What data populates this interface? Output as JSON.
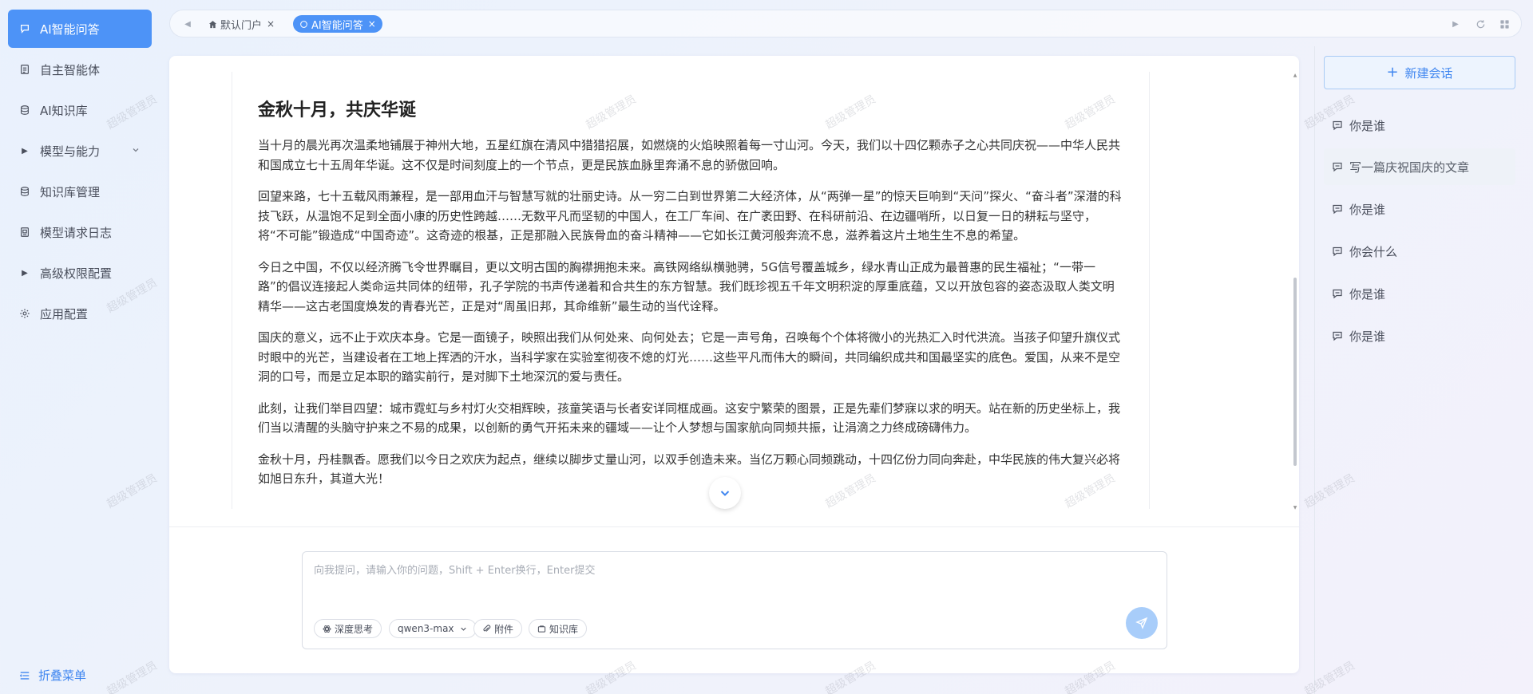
{
  "sidebar": {
    "items": [
      {
        "label": "AI智能问答",
        "icon": "chat-icon",
        "active": true
      },
      {
        "label": "自主智能体",
        "icon": "document-icon"
      },
      {
        "label": "AI知识库",
        "icon": "database-icon"
      },
      {
        "label": "模型与能力",
        "icon": "caret-right-icon",
        "expandable": true
      },
      {
        "label": "知识库管理",
        "icon": "database-icon"
      },
      {
        "label": "模型请求日志",
        "icon": "log-icon"
      },
      {
        "label": "高级权限配置",
        "icon": "caret-right-icon"
      },
      {
        "label": "应用配置",
        "icon": "gear-icon"
      }
    ],
    "collapse_label": "折叠菜单"
  },
  "tabs": [
    {
      "label": "默认门户",
      "icon": "home-icon",
      "active": false
    },
    {
      "label": "AI智能问答",
      "icon": "chat-icon",
      "active": true
    }
  ],
  "article": {
    "title": "金秋十月，共庆华诞",
    "paragraphs": [
      "当十月的晨光再次温柔地铺展于神州大地，五星红旗在清风中猎猎招展，如燃烧的火焰映照着每一寸山河。今天，我们以十四亿颗赤子之心共同庆祝——中华人民共和国成立七十五周年华诞。这不仅是时间刻度上的一个节点，更是民族血脉里奔涌不息的骄傲回响。",
      "回望来路，七十五载风雨兼程，是一部用血汗与智慧写就的壮丽史诗。从一穷二白到世界第二大经济体，从“两弹一星”的惊天巨响到“天问”探火、“奋斗者”深潜的科技飞跃，从温饱不足到全面小康的历史性跨越……无数平凡而坚韧的中国人，在工厂车间、在广袤田野、在科研前沿、在边疆哨所，以日复一日的耕耘与坚守，将“不可能”锻造成“中国奇迹”。这奇迹的根基，正是那融入民族骨血的奋斗精神——它如长江黄河般奔流不息，滋养着这片土地生生不息的希望。",
      "今日之中国，不仅以经济腾飞令世界瞩目，更以文明古国的胸襟拥抱未来。高铁网络纵横驰骋，5G信号覆盖城乡，绿水青山正成为最普惠的民生福祉；“一带一路”的倡议连接起人类命运共同体的纽带，孔子学院的书声传递着和合共生的东方智慧。我们既珍视五千年文明积淀的厚重底蕴，又以开放包容的姿态汲取人类文明精华——这古老国度焕发的青春光芒，正是对“周虽旧邦，其命维新”最生动的当代诠释。",
      "国庆的意义，远不止于欢庆本身。它是一面镜子，映照出我们从何处来、向何处去；它是一声号角，召唤每个个体将微小的光热汇入时代洪流。当孩子仰望升旗仪式时眼中的光芒，当建设者在工地上挥洒的汗水，当科学家在实验室彻夜不熄的灯光……这些平凡而伟大的瞬间，共同编织成共和国最坚实的底色。爱国，从来不是空洞的口号，而是立足本职的踏实前行，是对脚下土地深沉的爱与责任。",
      "此刻，让我们举目四望：城市霓虹与乡村灯火交相辉映，孩童笑语与长者安详同框成画。这安宁繁荣的图景，正是先辈们梦寐以求的明天。站在新的历史坐标上，我们当以清醒的头脑守护来之不易的成果，以创新的勇气开拓未来的疆域——让个人梦想与国家航向同频共振，让涓滴之力终成磅礴伟力。",
      "金秋十月，丹桂飘香。愿我们以今日之欢庆为起点，继续以脚步丈量山河，以双手创造未来。当亿万颗心同频跳动，十四亿份力同向奔赴，中华民族的伟大复兴必将如旭日东升，其道大光！"
    ]
  },
  "input": {
    "placeholder": "向我提问，请输入你的问题，Shift + Enter换行，Enter提交",
    "value": ""
  },
  "toolbar": {
    "deep_think": "深度思考",
    "model": "qwen3-max",
    "attachment": "附件",
    "knowledge": "知识库"
  },
  "right_panel": {
    "new_chat_label": "新建会话",
    "history": [
      {
        "label": "你是谁",
        "active": false
      },
      {
        "label": "写一篇庆祝国庆的文章",
        "active": true
      },
      {
        "label": "你是谁",
        "active": false
      },
      {
        "label": "你会什么",
        "active": false
      },
      {
        "label": "你是谁",
        "active": false
      },
      {
        "label": "你是谁",
        "active": false
      }
    ]
  },
  "watermark_text": "超级管理员",
  "colors": {
    "accent": "#4d93f7",
    "accent_text": "#3f86f0",
    "send_button": "#a8cdfa"
  }
}
